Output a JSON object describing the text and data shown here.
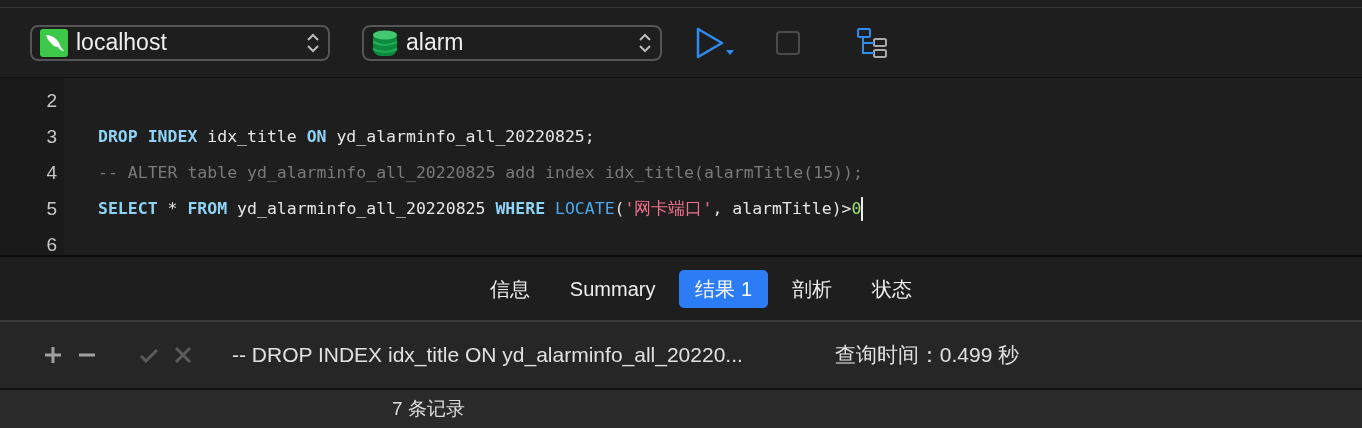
{
  "toolbar": {
    "connection": {
      "value": "localhost"
    },
    "database": {
      "value": "alarm"
    },
    "stop_disabled": true
  },
  "editor": {
    "lines": [
      {
        "number": "2"
      },
      {
        "number": "3",
        "tokens": [
          {
            "kind": "keyword",
            "text": "DROP INDEX"
          },
          {
            "kind": "plain",
            "text": " idx_title "
          },
          {
            "kind": "keyword",
            "text": "ON"
          },
          {
            "kind": "plain",
            "text": " yd_alarminfo_all_20220825;"
          }
        ]
      },
      {
        "number": "4",
        "tokens": [
          {
            "kind": "comment",
            "text": "-- ALTER table yd_alarminfo_all_20220825 add index idx_title(alarmTitle(15));"
          }
        ]
      },
      {
        "number": "5",
        "tokens": [
          {
            "kind": "keyword",
            "text": "SELECT"
          },
          {
            "kind": "plain",
            "text": " * "
          },
          {
            "kind": "keyword",
            "text": "FROM"
          },
          {
            "kind": "plain",
            "text": " yd_alarminfo_all_20220825 "
          },
          {
            "kind": "keyword",
            "text": "WHERE "
          },
          {
            "kind": "function",
            "text": "LOCATE"
          },
          {
            "kind": "plain",
            "text": "("
          },
          {
            "kind": "string",
            "text": "'网卡端口'"
          },
          {
            "kind": "plain",
            "text": ", alarmTitle)>"
          },
          {
            "kind": "number",
            "text": "0"
          }
        ],
        "cursor": true
      },
      {
        "number": "6"
      }
    ]
  },
  "tabs": [
    {
      "label": "信息",
      "selected": false
    },
    {
      "label": "Summary",
      "selected": false
    },
    {
      "label": "结果 1",
      "selected": true
    },
    {
      "label": "剖析",
      "selected": false
    },
    {
      "label": "状态",
      "selected": false
    }
  ],
  "result_bar": {
    "actions": [
      {
        "kind": "add",
        "disabled": false
      },
      {
        "kind": "remove",
        "disabled": false
      },
      {
        "kind": "apply",
        "disabled": true
      },
      {
        "kind": "cancel",
        "disabled": true
      }
    ],
    "query": "-- DROP INDEX idx_title ON yd_alarminfo_all_20220...",
    "query_time": "查询时间：0.499 秒"
  },
  "status_bar": {
    "records": "7 条记录"
  }
}
